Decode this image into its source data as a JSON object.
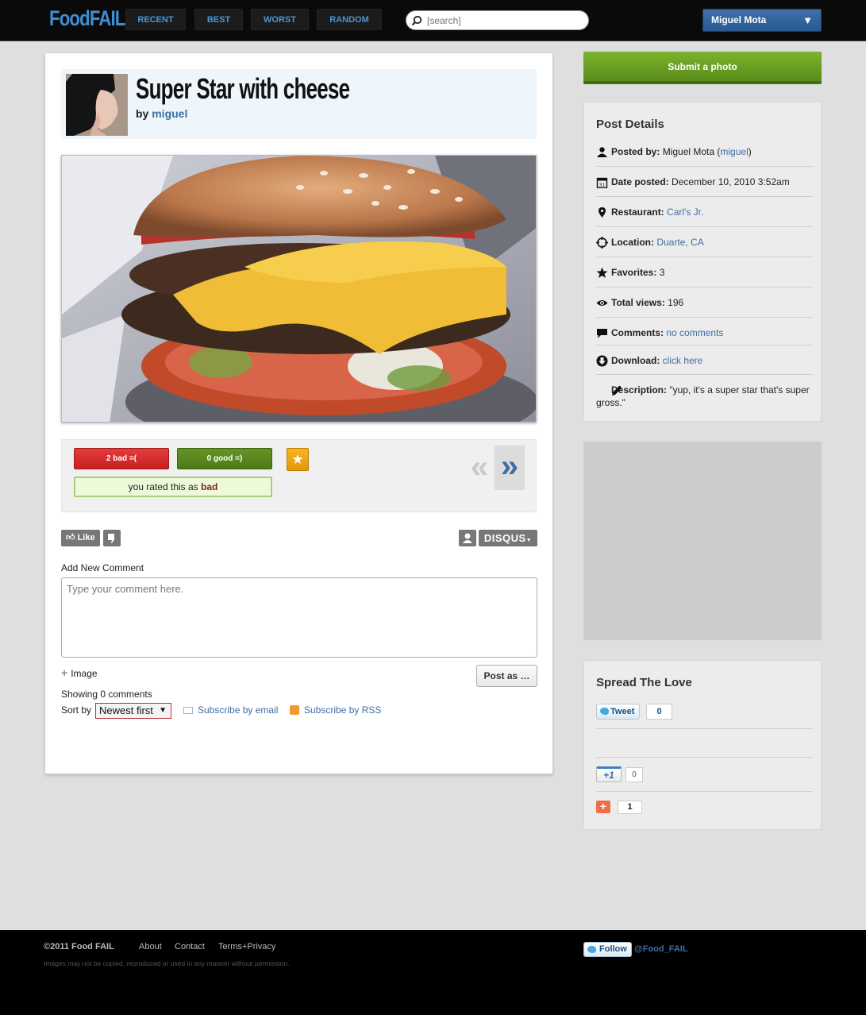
{
  "header": {
    "logo": "FoodFAIL",
    "nav": [
      "RECENT",
      "BEST",
      "WORST",
      "RANDOM"
    ],
    "search_placeholder": "[search]",
    "user_name": "Miguel Mota",
    "user_caret": "▼"
  },
  "post": {
    "title": "Super Star with cheese",
    "by_label": "by",
    "author": "miguel"
  },
  "rating": {
    "bad_label": "2 bad =(",
    "good_label": "0 good =)",
    "rated_prefix": "you rated this as",
    "rated_value": "bad",
    "prev": "«",
    "next": "»"
  },
  "comments": {
    "like_label": "Like",
    "disqus_label": "DISQUS",
    "add_comment_label": "Add New Comment",
    "comment_placeholder": "Type your comment here.",
    "image_label": "Image",
    "post_button": "Post as …",
    "showing": "Showing 0 comments",
    "sort_label": "Sort by",
    "sort_value": "Newest first",
    "subscribe_email": "Subscribe by email",
    "subscribe_rss": "Subscribe by RSS"
  },
  "sidebar": {
    "submit_button": "Submit a photo",
    "details_title": "Post Details",
    "details": [
      {
        "icon": "user-icon",
        "label": "Posted by:",
        "value": "Miguel Mota (",
        "link": "miguel",
        "suffix": ")"
      },
      {
        "icon": "calendar-icon",
        "label": "Date posted:",
        "value": "December 10, 2010 3:52am",
        "link": "",
        "suffix": ""
      },
      {
        "icon": "map-pin-icon",
        "label": "Restaurant:",
        "value": "",
        "link": "Carl's Jr.",
        "suffix": ""
      },
      {
        "icon": "crosshair-icon",
        "label": "Location:",
        "value": "",
        "link": "Duarte, CA",
        "suffix": ""
      },
      {
        "icon": "star-icon",
        "label": "Favorites:",
        "value": "3",
        "link": "",
        "suffix": ""
      },
      {
        "icon": "eye-icon",
        "label": "Total views:",
        "value": "196",
        "link": "",
        "suffix": ""
      },
      {
        "icon": "speech-bubble-icon",
        "label": "Comments:",
        "value": "",
        "link": "no comments",
        "suffix": ""
      },
      {
        "icon": "download-icon",
        "label": "Download:",
        "value": "",
        "link": "click here",
        "suffix": ""
      },
      {
        "icon": "pencil-icon",
        "label": "Description:",
        "value": "\"yup, it's a super star that's super gross.\"",
        "link": "",
        "suffix": ""
      }
    ],
    "spread_title": "Spread The Love",
    "tweet_label": "Tweet",
    "tweet_count": "0",
    "gplus_label": "+1",
    "gplus_count": "0",
    "addthis_count": "1"
  },
  "footer": {
    "copyright": "©2011 Food FAIL",
    "links": [
      "About",
      "Contact",
      "Terms+Privacy"
    ],
    "note": "Images may not be copied, reproduced or used in any manner without permission.",
    "follow_label": "Follow",
    "follow_handle": "@Food_FAIL"
  },
  "colors": {
    "accent": "#3d6ea6",
    "bad": "#d22b2b",
    "good": "#5c8a1f",
    "submit": "#6ba225"
  }
}
